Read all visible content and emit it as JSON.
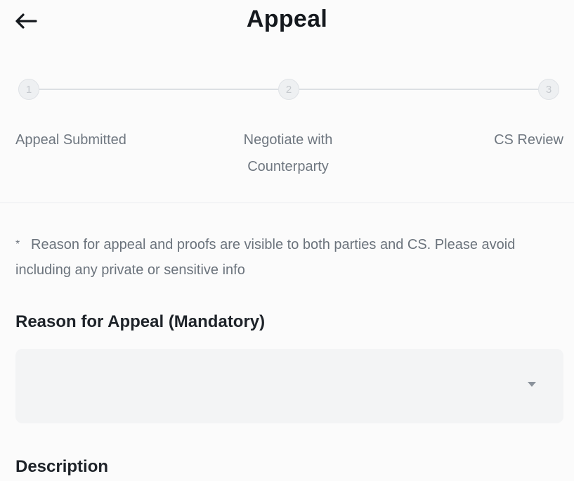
{
  "header": {
    "back_icon": "arrow-left-icon",
    "title": "Appeal"
  },
  "stepper": {
    "steps": [
      {
        "number": "1",
        "label": "Appeal Submitted"
      },
      {
        "number": "2",
        "label": "Negotiate with Counterparty"
      },
      {
        "number": "3",
        "label": "CS Review"
      }
    ]
  },
  "notice": {
    "marker": "*",
    "text": "Reason for appeal and proofs are visible to both parties and CS. Please avoid including any private or sensitive info"
  },
  "reason": {
    "label": "Reason for Appeal (Mandatory)",
    "value": "",
    "caret_icon": "caret-down-icon"
  },
  "description": {
    "label": "Description"
  },
  "colors": {
    "text_primary": "#1e2329",
    "text_secondary": "#6f7780",
    "input_bg": "#f3f4f5",
    "step_line": "#dcdfe3"
  }
}
